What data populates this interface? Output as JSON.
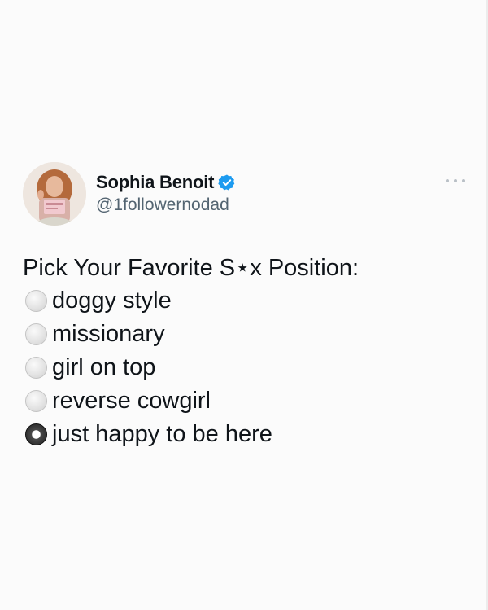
{
  "tweet": {
    "display_name": "Sophia Benoit",
    "handle": "@1followernodad",
    "text": "Pick Your Favorite S⋆x Position:",
    "options": [
      {
        "label": "doggy style",
        "selected": false
      },
      {
        "label": "missionary",
        "selected": false
      },
      {
        "label": "girl on top",
        "selected": false
      },
      {
        "label": "reverse cowgirl",
        "selected": false
      },
      {
        "label": "just happy to be here",
        "selected": true
      }
    ]
  },
  "icons": {
    "verified": "verified-badge-icon",
    "more": "more-options-icon",
    "radio_off": "radio-unselected-icon",
    "radio_on": "radio-selected-icon"
  },
  "colors": {
    "background": "#fbfbfb",
    "text": "#0f1419",
    "handle": "#536471",
    "verified": "#1d9bf0"
  }
}
